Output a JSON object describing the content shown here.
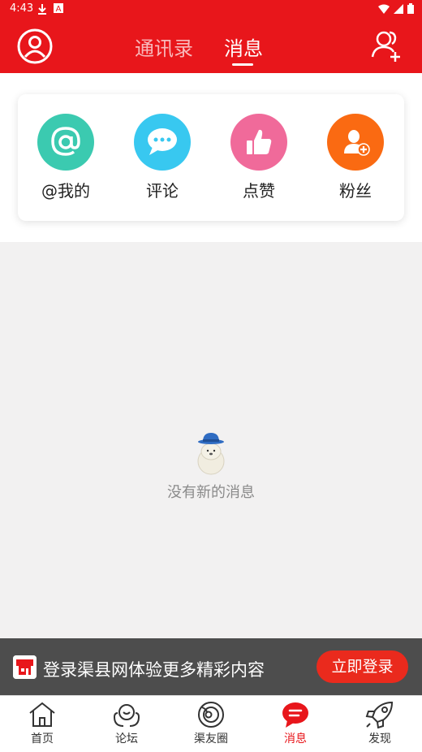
{
  "status_bar": {
    "time": "4:43"
  },
  "header": {
    "tabs": [
      {
        "label": "通讯录",
        "active": false
      },
      {
        "label": "消息",
        "active": true
      }
    ],
    "avatar_icon": "user-circle-icon",
    "add_friend_icon": "add-user-icon"
  },
  "categories": [
    {
      "label": "@我的",
      "icon": "at-icon",
      "color": "#3bcab0"
    },
    {
      "label": "评论",
      "icon": "chat-bubble-icon",
      "color": "#38c8f0"
    },
    {
      "label": "点赞",
      "icon": "thumbs-up-icon",
      "color": "#f06a9a"
    },
    {
      "label": "粉丝",
      "icon": "add-fan-icon",
      "color": "#fa6a12"
    }
  ],
  "empty_state": {
    "text": "没有新的消息",
    "icon": "bear-hat-icon"
  },
  "login_banner": {
    "text": "登录渠县网体验更多精彩内容",
    "button": "立即登录"
  },
  "bottom_nav": [
    {
      "label": "首页",
      "icon": "home-icon",
      "active": false
    },
    {
      "label": "论坛",
      "icon": "forum-icon",
      "active": false
    },
    {
      "label": "渠友圈",
      "icon": "circle-icon",
      "active": false
    },
    {
      "label": "消息",
      "icon": "message-icon",
      "active": true
    },
    {
      "label": "发现",
      "icon": "rocket-icon",
      "active": false
    }
  ],
  "colors": {
    "brand": "#e8161b",
    "banner_bg": "#4d4d4d",
    "login_button": "#ea2a1d"
  }
}
